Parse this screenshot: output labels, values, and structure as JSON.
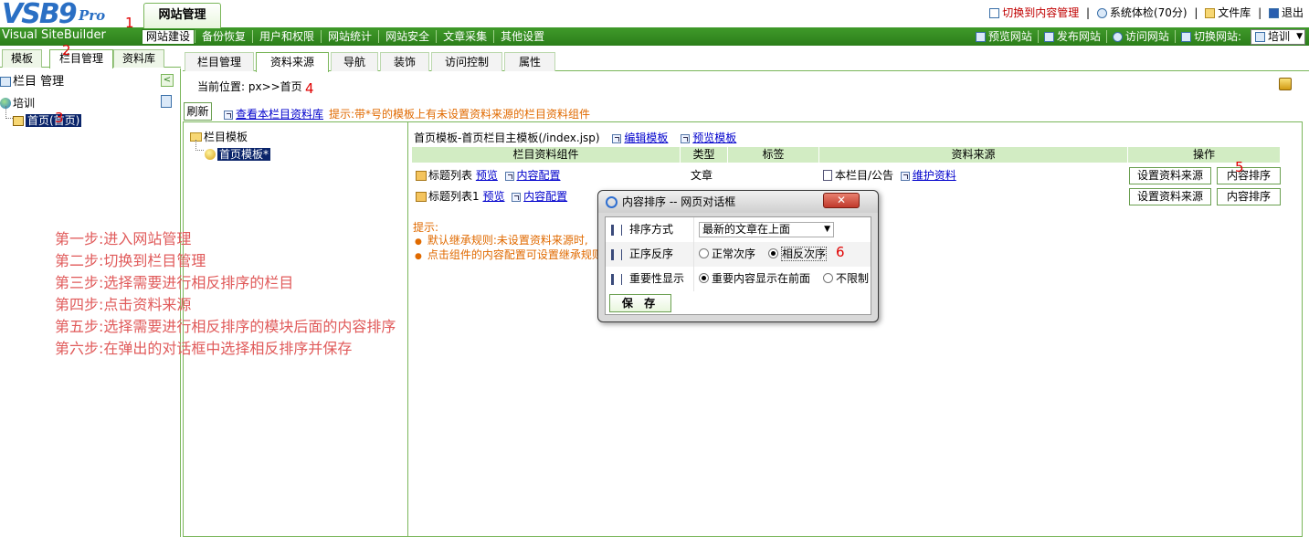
{
  "header": {
    "logo_main": "VSB9",
    "logo_pro": "Pro",
    "logo_sub": "Visual SiteBuilder",
    "site_tab": "网站管理",
    "top_links": [
      "切换到内容管理",
      "系统体检(70分)",
      "文件库",
      "退出"
    ],
    "main_nav": [
      "网站建设",
      "备份恢复",
      "用户和权限",
      "网站统计",
      "网站安全",
      "文章采集",
      "其他设置"
    ],
    "right_nav": [
      "预览网站",
      "发布网站",
      "访问网站",
      "切换网站:"
    ],
    "site_select": "培训"
  },
  "left": {
    "tabs": [
      "模板",
      "栏目管理",
      "资料库"
    ],
    "panel_title": "栏目 管理",
    "tree_root": "培训",
    "tree_child": "首页(首页)"
  },
  "content": {
    "tabs": [
      "栏目管理",
      "资料来源",
      "导航",
      "装饰",
      "访问控制",
      "属性"
    ],
    "breadcrumb": "当前位置: px>>首页",
    "refresh": "刷新",
    "view_lib": "查看本栏目资料库",
    "hint_top": "提示:带*号的模板上有未设置资料来源的栏目资料组件",
    "tpl_root": "栏目模板",
    "tpl_child": "首页模板*",
    "tpl_title": "首页模板-首页栏目主模板(/index.jsp)",
    "edit_tpl": "编辑模板",
    "preview_tpl": "预览模板",
    "columns": [
      "栏目资料组件",
      "类型",
      "标签",
      "资料来源",
      "操作"
    ],
    "rows": [
      {
        "name": "标题列表",
        "preview": "预览",
        "config": "内容配置",
        "type": "文章",
        "label": "",
        "source": "本栏目/公告",
        "maintain": "维护资料",
        "btn1": "设置资料来源",
        "btn2": "内容排序"
      },
      {
        "name": "标题列表1",
        "preview": "预览",
        "config": "内容配置",
        "type": "",
        "label": "",
        "source": "",
        "maintain": "",
        "btn1": "设置资料来源",
        "btn2": "内容排序"
      }
    ],
    "tips_head": "提示:",
    "tips": [
      "默认继承规则:未设置资料来源时,",
      "点击组件的内容配置可设置继承规则"
    ]
  },
  "steps": [
    "第一步:进入网站管理",
    "第二步:切换到栏目管理",
    "第三步:选择需要进行相反排序的栏目",
    "第四步:点击资料来源",
    "第五步:选择需要进行相反排序的模块后面的内容排序",
    "第六步:在弹出的对话框中选择相反排序并保存"
  ],
  "markers": [
    "1",
    "2",
    "3",
    "4",
    "5",
    "6"
  ],
  "dialog": {
    "title": "内容排序 -- 网页对话框",
    "sort_label": "排序方式",
    "sort_value": "最新的文章在上面",
    "order_label": "正序反序",
    "order_opt1": "正常次序",
    "order_opt2": "相反次序",
    "importance_label": "重要性显示",
    "imp_opt1": "重要内容显示在前面",
    "imp_opt2": "不限制",
    "save": "保 存"
  }
}
